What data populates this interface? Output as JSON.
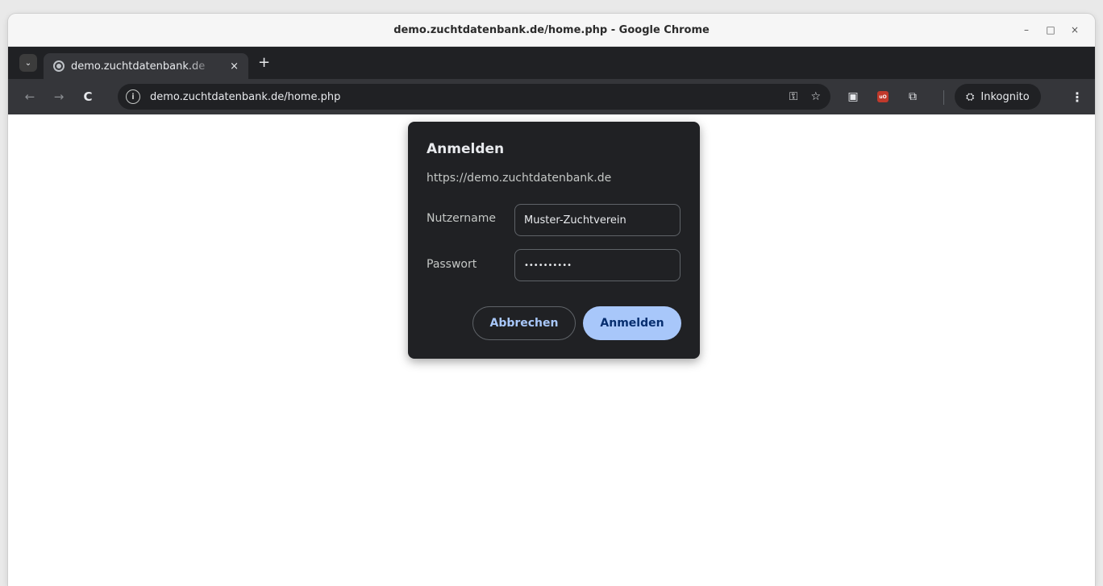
{
  "window": {
    "title": "demo.zuchtdatenbank.de/home.php - Google Chrome",
    "controls": {
      "minimize": "–",
      "maximize": "□",
      "close": "×"
    }
  },
  "tabs": [
    {
      "label": "demo.zuchtdatenbank.de",
      "close": "×",
      "icon": "globe-icon"
    }
  ],
  "tabbar": {
    "search_icon": "⌄",
    "new_tab": "+"
  },
  "toolbar": {
    "back": "←",
    "forward": "→",
    "reload": "C",
    "site_info": "i",
    "url": "demo.zuchtdatenbank.de/home.php",
    "key_icon": "⚿",
    "bookmark_icon": "☆",
    "extensions_icon": "⧉",
    "ublock_label": "uO",
    "incognito_label": "Inkognito",
    "menu": "⋮"
  },
  "dialog": {
    "title": "Anmelden",
    "origin": "https://demo.zuchtdatenbank.de",
    "username_label": "Nutzername",
    "username_value": "Muster-Zuchtverein",
    "password_label": "Passwort",
    "password_value": "••••••••••",
    "cancel_label": "Abbrechen",
    "submit_label": "Anmelden"
  }
}
